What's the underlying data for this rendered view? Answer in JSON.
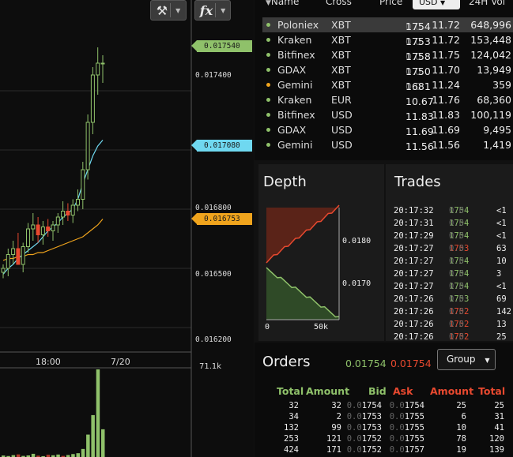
{
  "toolbar": {
    "tools_icon": "wrench-hammer-icon",
    "fx_label": "fx"
  },
  "price_axis": {
    "ticks": [
      "0.017400",
      "0.016800",
      "0.016500",
      "0.016200"
    ],
    "tags": {
      "last": "0.017540",
      "ma_fast": "0.017080",
      "ma_slow": "0.016753"
    }
  },
  "time_axis": {
    "labels": [
      "18:00",
      "7/20"
    ]
  },
  "volume_axis": {
    "max_label": "71.1k"
  },
  "markets": {
    "headers": {
      "name": "Name",
      "cross": "Cross",
      "price": "Price",
      "vol": "24H Vol"
    },
    "currency_select": "USD",
    "rows": [
      {
        "exchange": "Poloniex",
        "cross": "XBT",
        "price_dim": "0.0",
        "price": "1754",
        "usd": "11.72",
        "vol": "648,996",
        "dot": "#8fc16a",
        "selected": true
      },
      {
        "exchange": "Kraken",
        "cross": "XBT",
        "price_dim": "0.0",
        "price": "1753",
        "usd": "11.72",
        "vol": "153,448",
        "dot": "#8fc16a"
      },
      {
        "exchange": "Bitfinex",
        "cross": "XBT",
        "price_dim": "0.0",
        "price": "1758",
        "usd": "11.75",
        "vol": "124,042",
        "dot": "#8fc16a"
      },
      {
        "exchange": "GDAX",
        "cross": "XBT",
        "price_dim": "0.0",
        "price": "1750",
        "usd": "11.70",
        "vol": "13,949",
        "dot": "#8fc16a"
      },
      {
        "exchange": "Gemini",
        "cross": "XBT",
        "price_dim": "0.0",
        "price": "1681",
        "usd": "11.24",
        "vol": "359",
        "dot": "#f0a41d"
      },
      {
        "exchange": "Kraken",
        "cross": "EUR",
        "price_dim": "",
        "price": "10.67",
        "usd": "11.76",
        "vol": "68,360",
        "dot": "#8fc16a"
      },
      {
        "exchange": "Bitfinex",
        "cross": "USD",
        "price_dim": "",
        "price": "11.83",
        "usd": "11.83",
        "vol": "100,119",
        "dot": "#8fc16a"
      },
      {
        "exchange": "GDAX",
        "cross": "USD",
        "price_dim": "",
        "price": "11.69",
        "usd": "11.69",
        "vol": "9,495",
        "dot": "#8fc16a"
      },
      {
        "exchange": "Gemini",
        "cross": "USD",
        "price_dim": "",
        "price": "11.56",
        "usd": "11.56",
        "vol": "1,419",
        "dot": "#8fc16a"
      }
    ]
  },
  "depth": {
    "title": "Depth",
    "y_labels": [
      "0.0180",
      "0.0170"
    ],
    "x_labels": [
      "0",
      "50k"
    ]
  },
  "trades": {
    "title": "Trades",
    "rows": [
      {
        "time": "20:17:32",
        "dim": "0.0",
        "price": "1754",
        "amount": "<1",
        "side": "buy"
      },
      {
        "time": "20:17:31",
        "dim": "0.0",
        "price": "1754",
        "amount": "<1",
        "side": "buy"
      },
      {
        "time": "20:17:29",
        "dim": "0.0",
        "price": "1754",
        "amount": "<1",
        "side": "buy"
      },
      {
        "time": "20:17:27",
        "dim": "0.0",
        "price": "1753",
        "amount": "63",
        "side": "sell"
      },
      {
        "time": "20:17:27",
        "dim": "0.0",
        "price": "1754",
        "amount": "10",
        "side": "buy"
      },
      {
        "time": "20:17:27",
        "dim": "0.0",
        "price": "1754",
        "amount": "3",
        "side": "buy"
      },
      {
        "time": "20:17:27",
        "dim": "0.0",
        "price": "1754",
        "amount": "<1",
        "side": "buy"
      },
      {
        "time": "20:17:26",
        "dim": "0.0",
        "price": "1753",
        "amount": "69",
        "side": "buy"
      },
      {
        "time": "20:17:26",
        "dim": "0.0",
        "price": "1752",
        "amount": "142",
        "side": "sell"
      },
      {
        "time": "20:17:26",
        "dim": "0.0",
        "price": "1752",
        "amount": "13",
        "side": "sell"
      },
      {
        "time": "20:17:26",
        "dim": "0.0",
        "price": "1752",
        "amount": "25",
        "side": "sell"
      }
    ]
  },
  "orders": {
    "title": "Orders",
    "bid": "0.01754",
    "ask": "0.01754",
    "group_label": "Group",
    "headers": {
      "total": "Total",
      "amount": "Amount",
      "bid": "Bid",
      "ask": "Ask",
      "ask_amount": "Amount",
      "ask_total": "Total"
    },
    "rows": [
      {
        "total": "32",
        "amount": "32",
        "bid": "1754",
        "ask": "1754",
        "ask_amount": "25",
        "ask_total": "25"
      },
      {
        "total": "34",
        "amount": "2",
        "bid": "1753",
        "ask": "1755",
        "ask_amount": "6",
        "ask_total": "31"
      },
      {
        "total": "132",
        "amount": "99",
        "bid": "1753",
        "ask": "1755",
        "ask_amount": "10",
        "ask_total": "41"
      },
      {
        "total": "253",
        "amount": "121",
        "bid": "1752",
        "ask": "1755",
        "ask_amount": "78",
        "ask_total": "120"
      },
      {
        "total": "424",
        "amount": "171",
        "bid": "1752",
        "ask": "1757",
        "ask_amount": "19",
        "ask_total": "139"
      }
    ],
    "price_prefix": "0.0"
  },
  "colors": {
    "up": "#8fc16a",
    "down": "#e8492f",
    "ma_fast": "#6fd8f0",
    "ma_slow": "#f0a41d"
  },
  "chart_data": {
    "type": "candlestick",
    "price_range": [
      0.0161,
      0.0177
    ],
    "candles": [
      [
        0.01648,
        0.01652,
        0.01645,
        0.0165
      ],
      [
        0.0165,
        0.0166,
        0.01646,
        0.01657
      ],
      [
        0.01657,
        0.01664,
        0.01652,
        0.0166
      ],
      [
        0.0166,
        0.01668,
        0.01655,
        0.01652
      ],
      [
        0.01652,
        0.01663,
        0.01648,
        0.01661
      ],
      [
        0.01661,
        0.01673,
        0.01658,
        0.0167
      ],
      [
        0.0167,
        0.01678,
        0.01664,
        0.01672
      ],
      [
        0.01672,
        0.01676,
        0.01663,
        0.01667
      ],
      [
        0.01667,
        0.01674,
        0.01662,
        0.01671
      ],
      [
        0.01671,
        0.01675,
        0.01666,
        0.01669
      ],
      [
        0.01669,
        0.01674,
        0.01664,
        0.01672
      ],
      [
        0.01672,
        0.01678,
        0.01668,
        0.01676
      ],
      [
        0.01676,
        0.01684,
        0.01672,
        0.01679
      ],
      [
        0.01679,
        0.01683,
        0.01674,
        0.01677
      ],
      [
        0.01677,
        0.01685,
        0.01673,
        0.01682
      ],
      [
        0.01682,
        0.0169,
        0.01679,
        0.01685
      ],
      [
        0.01685,
        0.01704,
        0.0168,
        0.017
      ],
      [
        0.017,
        0.01728,
        0.01695,
        0.01724
      ],
      [
        0.01724,
        0.01752,
        0.01718,
        0.01748
      ],
      [
        0.01748,
        0.01762,
        0.01738,
        0.01754
      ],
      [
        0.01754,
        0.01758,
        0.01744,
        0.01754
      ]
    ],
    "ma_fast": [
      0.01647,
      0.0165,
      0.01652,
      0.01655,
      0.01657,
      0.01659,
      0.01661,
      0.01663,
      0.01666,
      0.01669,
      0.01671,
      0.01673,
      0.01676,
      0.01678,
      0.0168,
      0.01685,
      0.01693,
      0.017,
      0.01707,
      0.01712,
      0.01715
    ],
    "ma_slow": [
      0.01654,
      0.01655,
      0.01655,
      0.01656,
      0.01656,
      0.01657,
      0.01657,
      0.01658,
      0.01658,
      0.01659,
      0.0166,
      0.01661,
      0.01662,
      0.01663,
      0.01664,
      0.01665,
      0.01666,
      0.01668,
      0.0167,
      0.01672,
      0.01675
    ],
    "volume": [
      1.2,
      0.8,
      1.5,
      2.1,
      0.9,
      1.3,
      2.6,
      1.1,
      0.7,
      1.8,
      1.4,
      2.0,
      0.9,
      1.6,
      2.4,
      3.1,
      6.5,
      18.2,
      34.0,
      71.1,
      22.5
    ],
    "volume_down": [
      false,
      false,
      false,
      true,
      false,
      false,
      false,
      true,
      false,
      true,
      false,
      false,
      true,
      false,
      false,
      false,
      false,
      false,
      false,
      false,
      false
    ]
  }
}
